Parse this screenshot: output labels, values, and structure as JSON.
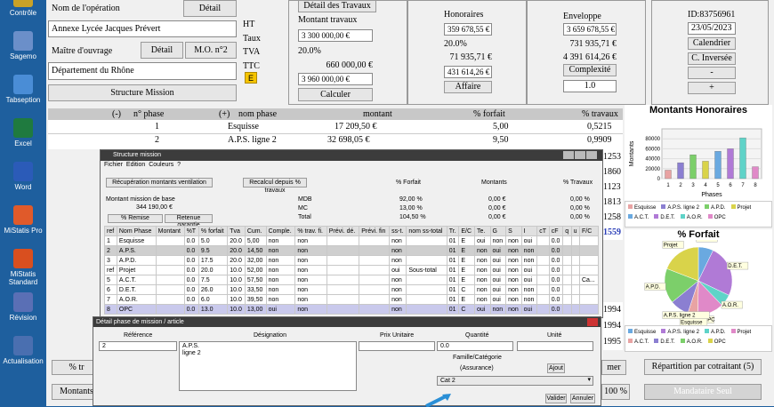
{
  "desktop": {
    "icons": [
      {
        "label": "Contrôle",
        "color": "#c9a227"
      },
      {
        "label": "Sagemo",
        "color": "#6b8fc9"
      },
      {
        "label": "Tabseption",
        "color": "#4a8dd6"
      },
      {
        "label": "Excel",
        "color": "#1f7a3f"
      },
      {
        "label": "Word",
        "color": "#2b5bb8"
      },
      {
        "label": "MiStatis Pro",
        "color": "#e05a2a"
      },
      {
        "label": "MiStatis Standard",
        "color": "#d94f1f"
      },
      {
        "label": "Révision",
        "color": "#5a6fb5"
      },
      {
        "label": "Actualisation",
        "color": "#4a6fb0"
      }
    ]
  },
  "op": {
    "nom_label": "Nom de l'opération",
    "detail_btn": "Détail",
    "nom_value": "Annexe Lycée Jacques Prévert",
    "mo_label": "Maître d'ouvrage",
    "mo_detail_btn": "Détail",
    "mo2_btn": "M.O. n°2",
    "dept": "Département du Rhône",
    "structure_btn": "Structure Mission"
  },
  "travaux": {
    "detail_btn": "Détail des Travaux",
    "montant_label": "Montant travaux",
    "ht": "HT",
    "taux": "Taux",
    "tva": "TVA",
    "ttc": "TTC",
    "e_badge": "E",
    "montant_value": "3 300 000,00 €",
    "tva_rate": "20.0%",
    "tva_amount": "660 000,00 €",
    "ttc_value": "3 960 000,00 €",
    "calc_btn": "Calculer"
  },
  "hono": {
    "title": "Honoraires",
    "ht": "359 678,55 €",
    "rate": "20.0%",
    "tva": "71 935,71 €",
    "ttc": "431 614,26 €",
    "affaire_btn": "Affaire"
  },
  "env": {
    "title": "Enveloppe",
    "ht": "3 659 678,55 €",
    "tva": "731 935,71 €",
    "ttc": "4 391 614,26 €",
    "complexite_btn": "Complexité",
    "complexite_value": "1.0"
  },
  "id": {
    "id_text": "ID:83756961",
    "date": "23/05/2023",
    "calendar_btn": "Calendrier",
    "inverse_btn": "C. Inversée",
    "minus_btn": "-",
    "plus_btn": "+"
  },
  "phases": {
    "headers": [
      "(-)",
      "n° phase",
      "(+)",
      "nom phase",
      "montant",
      "% forfait",
      "% travaux"
    ],
    "rows": [
      {
        "n": "1",
        "nom": "Esquisse",
        "montant": "17 209,50 €",
        "forfait": "5,00",
        "travaux": "0,5215"
      },
      {
        "n": "2",
        "nom": "A.P.S. ligne 2",
        "montant": "32 698,05 €",
        "forfait": "9,50",
        "travaux": "0,9909"
      }
    ],
    "right_partial": [
      "1253",
      "1860",
      "1123",
      "1813",
      "1258",
      "1559"
    ],
    "right_partial2": [
      "1994",
      "1994",
      "1995"
    ]
  },
  "bottom": {
    "pct_tr": "% tr",
    "montants": "Montants",
    "mer": "mer",
    "pct100": "100 %",
    "repartition_btn": "Répartition par cotraitant (5)",
    "mandataire_btn": "Mandataire Seul"
  },
  "chart_data": [
    {
      "type": "bar",
      "title": "Montants Honoraires",
      "xlabel": "Phases",
      "ylabel": "Montants",
      "categories": [
        "1",
        "2",
        "3",
        "4",
        "5",
        "6",
        "7",
        "8"
      ],
      "values": [
        17000,
        32000,
        48000,
        35000,
        55000,
        60000,
        82000,
        24000
      ],
      "ylim": [
        0,
        100000
      ],
      "yticks": [
        "0",
        "20000",
        "40000",
        "60000",
        "80000"
      ],
      "colors": [
        "#e8a3a3",
        "#8b7fd1",
        "#7ccf6a",
        "#d9d34a",
        "#6aa9e0",
        "#b07ad6",
        "#5fd3c8",
        "#e089c8"
      ],
      "legend": [
        "Esquisse",
        "A.P.S. ligne 2",
        "A.P.D.",
        "Projet",
        "A.C.T.",
        "D.E.T.",
        "A.O.R.",
        "OPC"
      ]
    },
    {
      "type": "pie",
      "title": "% Forfait",
      "labels": [
        "A.C.T.",
        "D.E.T.",
        "A.O.R.",
        "OPC",
        "Esquisse",
        "A.P.S. ligne 2",
        "A.P.D.",
        "Projet"
      ],
      "values": [
        7.5,
        26,
        6,
        13,
        5,
        9.5,
        17.5,
        20
      ],
      "colors": [
        "#6aa9e0",
        "#b07ad6",
        "#5fd3c8",
        "#e089c8",
        "#e8a3a3",
        "#8b7fd1",
        "#7ccf6a",
        "#d9d34a"
      ],
      "legend": [
        "Esquisse",
        "A.P.S. ligne 2",
        "A.P.D.",
        "Projet",
        "A.C.T.",
        "D.E.T.",
        "A.O.R.",
        "OPC"
      ]
    }
  ],
  "structure": {
    "title": "Structure mission",
    "menu": [
      "Fichier",
      "Edition",
      "Couleurs",
      "?"
    ],
    "recup_btn": "Récupération montants ventilation",
    "recalcul_btn": "Recalcul depuis % travaux",
    "col_forfait": "% Forfait",
    "col_montants": "Montants",
    "col_travaux": "% Travaux",
    "base_label": "Montant mission de base",
    "base_value": "344 190,00 €",
    "mdb": "MDB",
    "mc": "MC",
    "total": "Total",
    "mdb_vals": [
      "92,00 %",
      "0,00 €",
      "0,00 %"
    ],
    "mc_vals": [
      "13,00 %",
      "0,00 €",
      "0,00 %"
    ],
    "total_vals": [
      "104,50 %",
      "0,00 €",
      "0,00 %"
    ],
    "remise_btn": "% Remise",
    "retenue_btn": "Retenue garantie",
    "headers": [
      "ref",
      "Nom Phase",
      "Montant",
      "%T",
      "% forfait",
      "Tva",
      "Cum.",
      "Comple.",
      "% trav. fi.",
      "Prévi. dé.",
      "Prévi. fin",
      "ss-t.",
      "nom ss-total",
      "Tr.",
      "E/C",
      "Te.",
      "G",
      "S",
      "I",
      "cT",
      "cF",
      "q",
      "u",
      "F/C"
    ],
    "rows": [
      [
        "1",
        "Esquisse",
        "",
        "0.0",
        "5.0",
        "20.0",
        "5,00",
        "non",
        "non",
        "",
        "",
        "non",
        "",
        "01",
        "E",
        "oui",
        "non",
        "non",
        "oui",
        "",
        "0.0",
        "",
        "",
        ""
      ],
      [
        "2",
        "A.P.S.",
        "",
        "0.0",
        "9.5",
        "20.0",
        "14,50",
        "non",
        "non",
        "",
        "",
        "non",
        "",
        "01",
        "E",
        "non",
        "oui",
        "non",
        "non",
        "",
        "0.0",
        "",
        "",
        ""
      ],
      [
        "3",
        "A.P.D.",
        "",
        "0.0",
        "17.5",
        "20.0",
        "32,00",
        "non",
        "non",
        "",
        "",
        "non",
        "",
        "01",
        "E",
        "non",
        "oui",
        "non",
        "non",
        "",
        "0.0",
        "",
        "",
        ""
      ],
      [
        "ref",
        "Projet",
        "",
        "0.0",
        "20.0",
        "10.0",
        "52,00",
        "non",
        "non",
        "",
        "",
        "oui",
        "Sous-total",
        "01",
        "E",
        "non",
        "oui",
        "non",
        "oui",
        "",
        "0.0",
        "",
        "",
        ""
      ],
      [
        "5",
        "A.C.T.",
        "",
        "0.0",
        "7.5",
        "10.0",
        "57,50",
        "non",
        "non",
        "",
        "",
        "non",
        "",
        "01",
        "E",
        "non",
        "oui",
        "non",
        "oui",
        "",
        "0.0",
        "",
        "",
        "Ca..."
      ],
      [
        "6",
        "D.E.T.",
        "",
        "0.0",
        "26.0",
        "10.0",
        "33,50",
        "non",
        "non",
        "",
        "",
        "non",
        "",
        "01",
        "C",
        "non",
        "oui",
        "non",
        "non",
        "",
        "0.0",
        "",
        "",
        ""
      ],
      [
        "7",
        "A.O.R.",
        "",
        "0.0",
        "6.0",
        "10.0",
        "39,50",
        "non",
        "non",
        "",
        "",
        "non",
        "",
        "01",
        "E",
        "non",
        "oui",
        "non",
        "non",
        "",
        "0.0",
        "",
        "",
        ""
      ],
      [
        "8",
        "OPC",
        "",
        "0.0",
        "13.0",
        "10.0",
        "13,00",
        "oui",
        "non",
        "",
        "",
        "non",
        "",
        "01",
        "C",
        "oui",
        "non",
        "non",
        "oui",
        "",
        "0.0",
        "",
        "",
        ""
      ]
    ]
  },
  "detail": {
    "title": "Détail phase de mission / article",
    "headers": [
      "Référence",
      "Désignation",
      "Prix Unitaire",
      "Quantité",
      "Unité"
    ],
    "ref": "2",
    "designation": "A.P.S.\nligne 2",
    "prix": "",
    "quantite": "0.0",
    "unite": "",
    "famille_label": "Famille/Catégorie",
    "famille_value": "(Assurance)",
    "ajout_btn": "Ajout",
    "cat_value": "Cat 2",
    "valider_btn": "Valider",
    "annuler_btn": "Annuler"
  }
}
